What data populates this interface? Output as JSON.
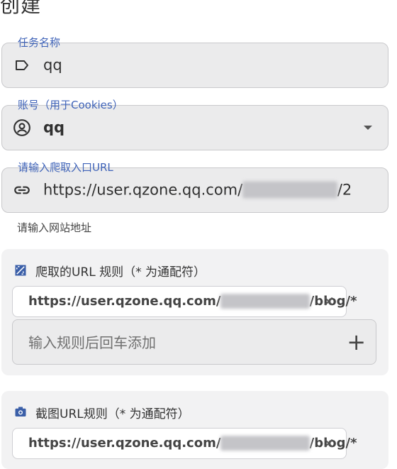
{
  "page": {
    "title": "创建"
  },
  "task_name": {
    "label": "任务名称",
    "value": "qq",
    "icon": "tag-icon"
  },
  "account": {
    "label": "账号（用于Cookies）",
    "value": "qq",
    "icon": "account-circle-icon"
  },
  "entry_url": {
    "label": "请输入爬取入口URL",
    "value_prefix": "https://user.qzone.qq.com/",
    "value_blurred": "3764922889",
    "value_suffix": "/2",
    "hint": "请输入网站地址",
    "icon": "link-icon"
  },
  "crawl_rules": {
    "title": "爬取的URL 规则（* 为通配符）",
    "icon": "transform-icon",
    "chip_prefix": "https://user.qzone.qq.com/",
    "chip_blurred": "3764922889",
    "chip_suffix": "/blog/*",
    "input_placeholder": "输入规则后回车添加"
  },
  "screenshot_rules": {
    "title": "截图URL规则（* 为通配符）",
    "icon": "camera-icon",
    "chip_prefix": "https://user.qzone.qq.com/",
    "chip_blurred": "3764922889",
    "chip_suffix": "/blog/*"
  },
  "colors": {
    "label_accent": "#3f63b8",
    "field_bg": "#ebebec",
    "card_bg": "#f2f2f3"
  }
}
